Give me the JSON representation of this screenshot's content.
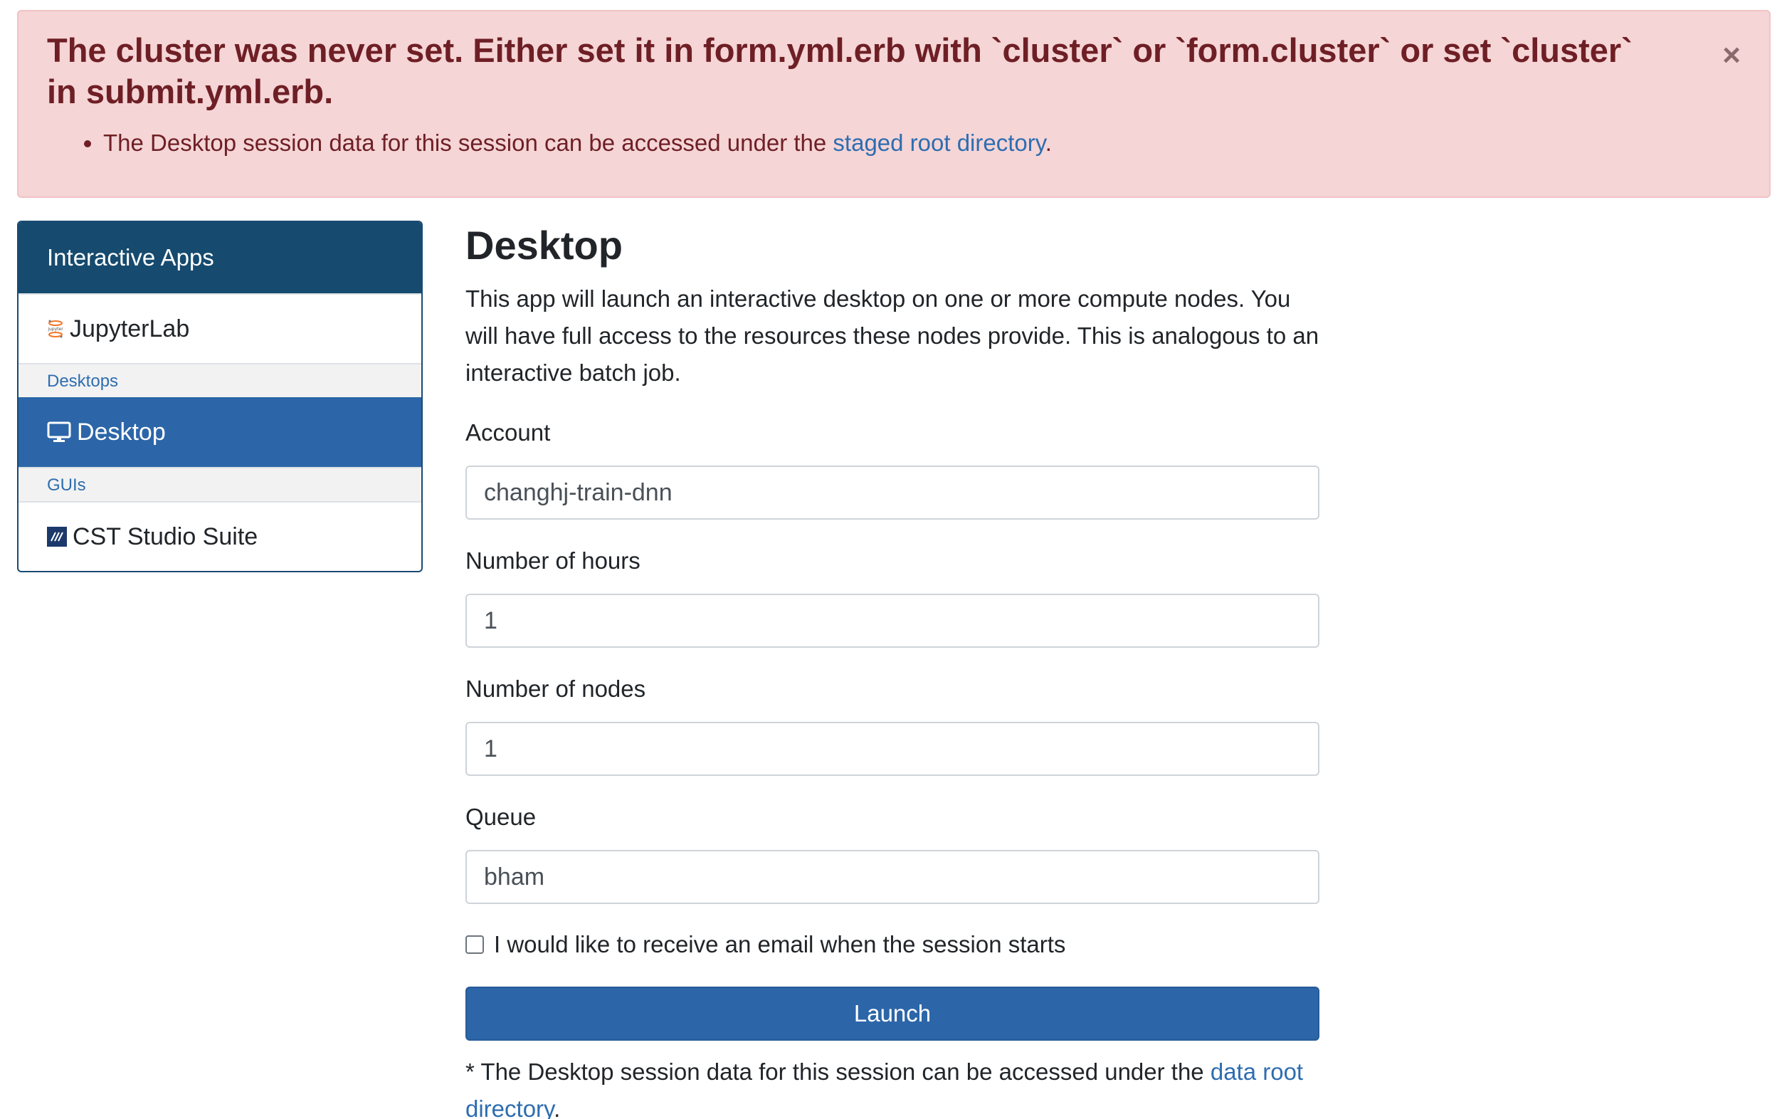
{
  "alert": {
    "title": "The cluster was never set. Either set it in form.yml.erb with `cluster` or `form.cluster` or set `cluster` in submit.yml.erb.",
    "message_prefix": "The Desktop session data for this session can be accessed under the ",
    "message_link": "staged root directory",
    "message_suffix": ".",
    "close_glyph": "×"
  },
  "sidebar": {
    "header": "Interactive Apps",
    "items": [
      {
        "type": "item",
        "label": "JupyterLab",
        "icon": "jupyter-icon"
      },
      {
        "type": "category",
        "label": "Desktops"
      },
      {
        "type": "item",
        "label": "Desktop",
        "icon": "monitor-icon",
        "active": true
      },
      {
        "type": "category",
        "label": "GUIs"
      },
      {
        "type": "item",
        "label": "CST Studio Suite",
        "icon": "cst-icon"
      }
    ]
  },
  "main": {
    "title": "Desktop",
    "description": "This app will launch an interactive desktop on one or more compute nodes. You will have full access to the resources these nodes provide. This is analogous to an interactive batch job.",
    "fields": {
      "account": {
        "label": "Account",
        "value": "changhj-train-dnn"
      },
      "hours": {
        "label": "Number of hours",
        "value": "1"
      },
      "nodes": {
        "label": "Number of nodes",
        "value": "1"
      },
      "queue": {
        "label": "Queue",
        "value": "bham"
      }
    },
    "email_checkbox": {
      "label": "I would like to receive an email when the session starts",
      "checked": false
    },
    "launch_label": "Launch",
    "footnote_prefix": "* The Desktop session data for this session can be accessed under the ",
    "footnote_link": "data root directory",
    "footnote_suffix": "."
  },
  "colors": {
    "alert_bg": "#f5d5d6",
    "alert_text": "#6e1f25",
    "sidebar_header": "#164a6e",
    "active": "#2c66a8",
    "link": "#2e6db0"
  }
}
